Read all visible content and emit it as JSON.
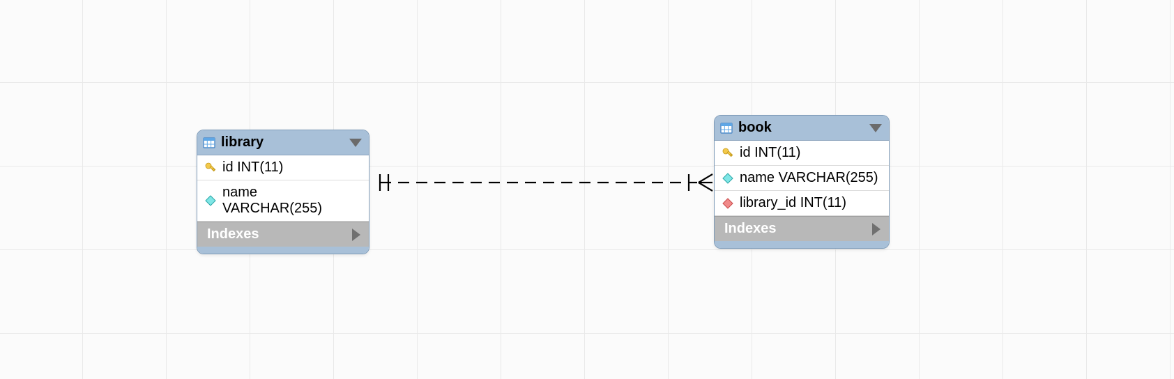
{
  "entities": [
    {
      "name": "library",
      "columns": [
        {
          "icon": "key",
          "text": "id INT(11)"
        },
        {
          "icon": "diamond-cyan",
          "text": "name VARCHAR(255)"
        }
      ],
      "indexes_label": "Indexes"
    },
    {
      "name": "book",
      "columns": [
        {
          "icon": "key",
          "text": "id INT(11)"
        },
        {
          "icon": "diamond-cyan",
          "text": "name VARCHAR(255)"
        },
        {
          "icon": "diamond-red",
          "text": "library_id INT(11)"
        }
      ],
      "indexes_label": "Indexes"
    }
  ],
  "relationship": {
    "from": "library",
    "to": "book",
    "from_cardinality": "one",
    "to_cardinality": "many",
    "style": "dashed"
  }
}
